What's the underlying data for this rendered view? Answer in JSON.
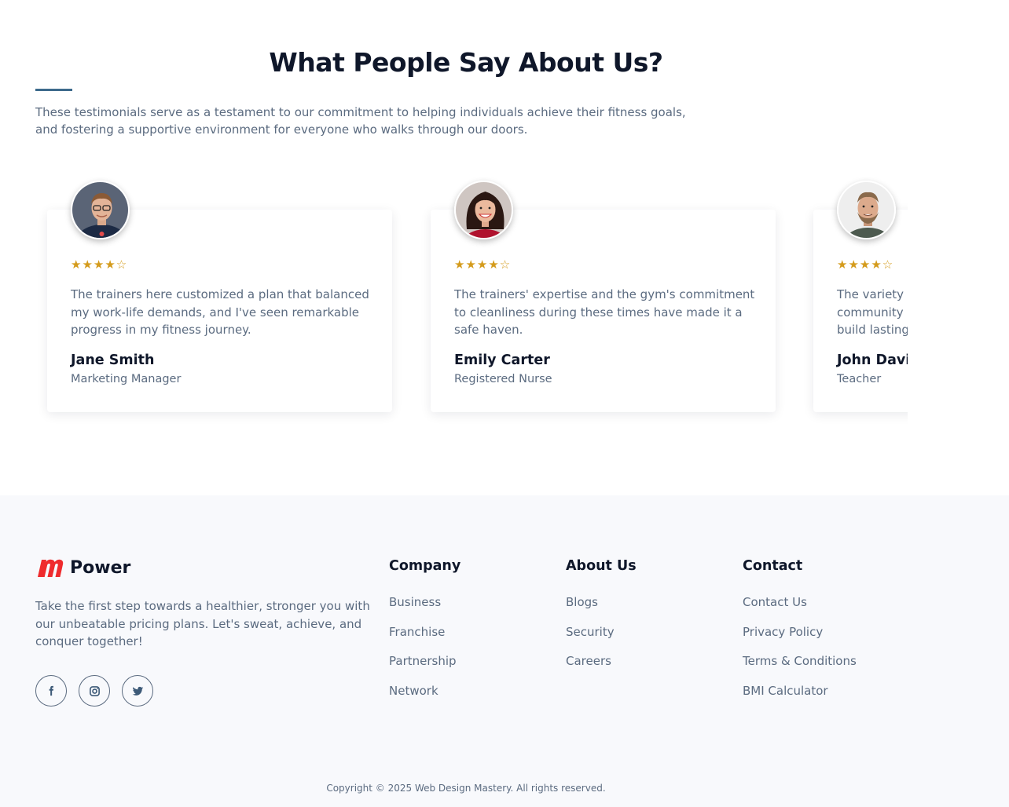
{
  "testimonials": {
    "heading": "What People Say About Us?",
    "intro": "These testimonials serve as a testament to our commitment to helping individuals achieve their fitness goals, and fostering a supportive environment for everyone who walks through our doors.",
    "star_rating": "★★★★☆",
    "rating_value": 4,
    "cards": [
      {
        "quote": "The trainers here customized a plan that balanced my work-life demands, and I've seen remarkable progress in my fitness journey.",
        "name": "Jane Smith",
        "role": "Marketing Manager"
      },
      {
        "quote": "The trainers' expertise and the gym's commitment to cleanliness during these times have made it a safe haven.",
        "name": "Emily Carter",
        "role": "Registered Nurse"
      },
      {
        "quote": "The variety of classes and the supportive community helped me shed the extra pounds and build lasting habits.",
        "name": "John Davis",
        "role": "Teacher"
      }
    ]
  },
  "footer": {
    "brand": "Power",
    "about": "Take the first step towards a healthier, stronger you with our unbeatable pricing plans. Let's sweat, achieve, and conquer together!",
    "socials": [
      "facebook-icon",
      "instagram-icon",
      "twitter-icon"
    ],
    "columns": [
      {
        "title": "Company",
        "links": [
          "Business",
          "Franchise",
          "Partnership",
          "Network"
        ]
      },
      {
        "title": "About Us",
        "links": [
          "Blogs",
          "Security",
          "Careers"
        ]
      },
      {
        "title": "Contact",
        "links": [
          "Contact Us",
          "Privacy Policy",
          "Terms & Conditions",
          "BMI Calculator"
        ]
      }
    ],
    "copyright": "Copyright © 2025 Web Design Mastery. All rights reserved."
  },
  "colors": {
    "accent_underline": "#3d6a8c",
    "star": "#d49b1c",
    "brand_red": "#ef2b2d",
    "text_dark": "#0f172a",
    "text_muted": "#5b6b80",
    "footer_bg": "#f8f9fc"
  }
}
